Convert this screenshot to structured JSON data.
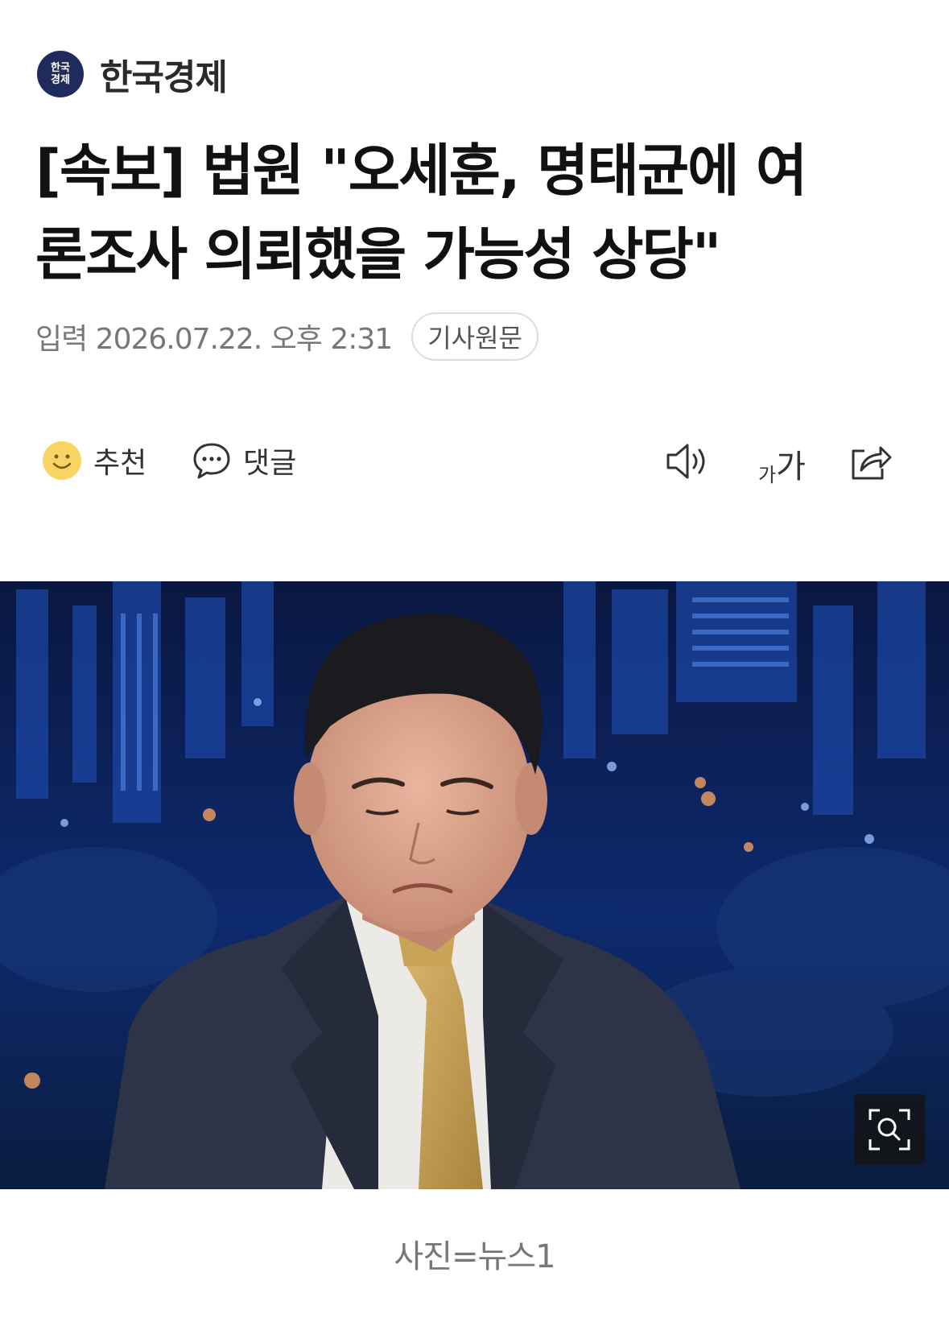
{
  "publisher": {
    "logo_line1": "한국",
    "logo_line2": "경제",
    "name": "한국경제",
    "brand_color": "#1f2b5c"
  },
  "article": {
    "headline_line1": "[속보] 법원 \"오세훈, 명태균에 여",
    "headline_line2": "론조사 의뢰했을 가능성 상당\"",
    "date": "입력 2026.07.22. 오후 2:31",
    "original_label": "기사원문"
  },
  "actions": {
    "recommend_label": "추천",
    "comment_label": "댓글",
    "font_small": "가",
    "font_large": "가",
    "icons": [
      "smiley-icon",
      "speech-bubble-icon",
      "speaker-icon",
      "font-size-icon",
      "share-icon"
    ]
  },
  "photo": {
    "caption": "사진=뉴스1",
    "zoom_icon": "zoom-icon"
  }
}
